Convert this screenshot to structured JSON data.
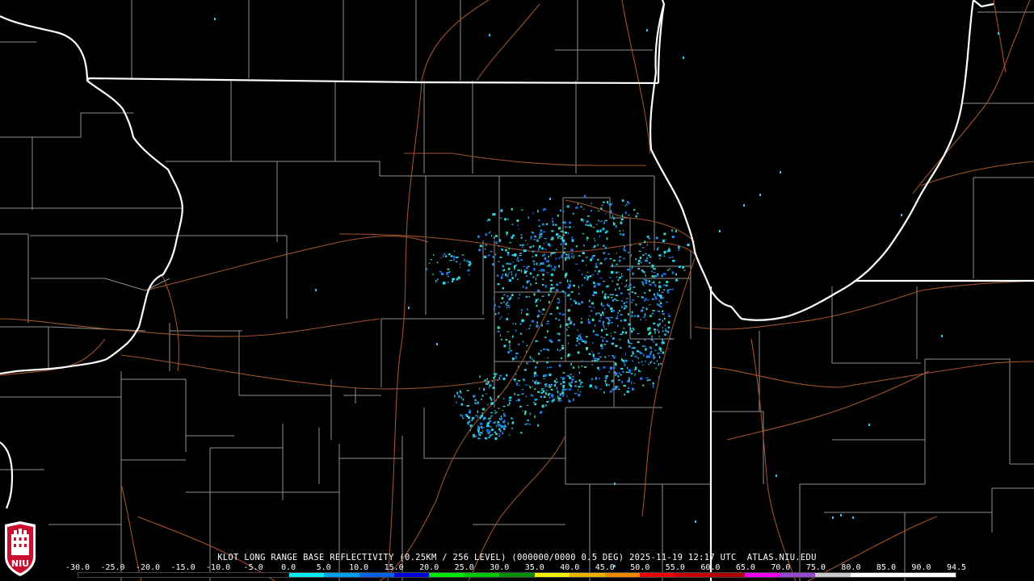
{
  "footer": {
    "title": "KLOT LONG RANGE BASE REFLECTIVITY (0.25KM / 256 LEVEL) (000000/0000 0.5 DEG) 2025-11-19 12:17 UTC  ATLAS.NIU.EDU"
  },
  "scale": {
    "labels": [
      "-30.0",
      "-25.0",
      "-20.0",
      "-15.0",
      "-10.0",
      "-5.0",
      "0.0",
      "5.0",
      "10.0",
      "15.0",
      "20.0",
      "25.0",
      "30.0",
      "35.0",
      "40.0",
      "45.0",
      "50.0",
      "55.0",
      "60.0",
      "65.0",
      "70.0",
      "75.0",
      "80.0",
      "85.0",
      "90.0",
      "94.5"
    ],
    "colors": [
      "#000000",
      "#000000",
      "#000000",
      "#000000",
      "#000000",
      "#000000",
      "#00f0f0",
      "#00a0f0",
      "#0060e8",
      "#0000d8",
      "#00e800",
      "#00c800",
      "#008c00",
      "#f0f000",
      "#e8b400",
      "#f08800",
      "#f00000",
      "#c80000",
      "#b00000",
      "#f000f0",
      "#9848d0",
      "#c8c8c8",
      "#ffffff",
      "#ffffff",
      "#ffffff"
    ]
  },
  "logo": {
    "text": "NIU"
  },
  "colors": {
    "background": "#000000",
    "state_border": "#ffffff",
    "county_border": "#9a9a9a",
    "highway": "#a0522d",
    "echo_light": "#2fc6e8",
    "echo_mid": "#2b8ff0",
    "echo_teal": "#3fd0b8"
  }
}
